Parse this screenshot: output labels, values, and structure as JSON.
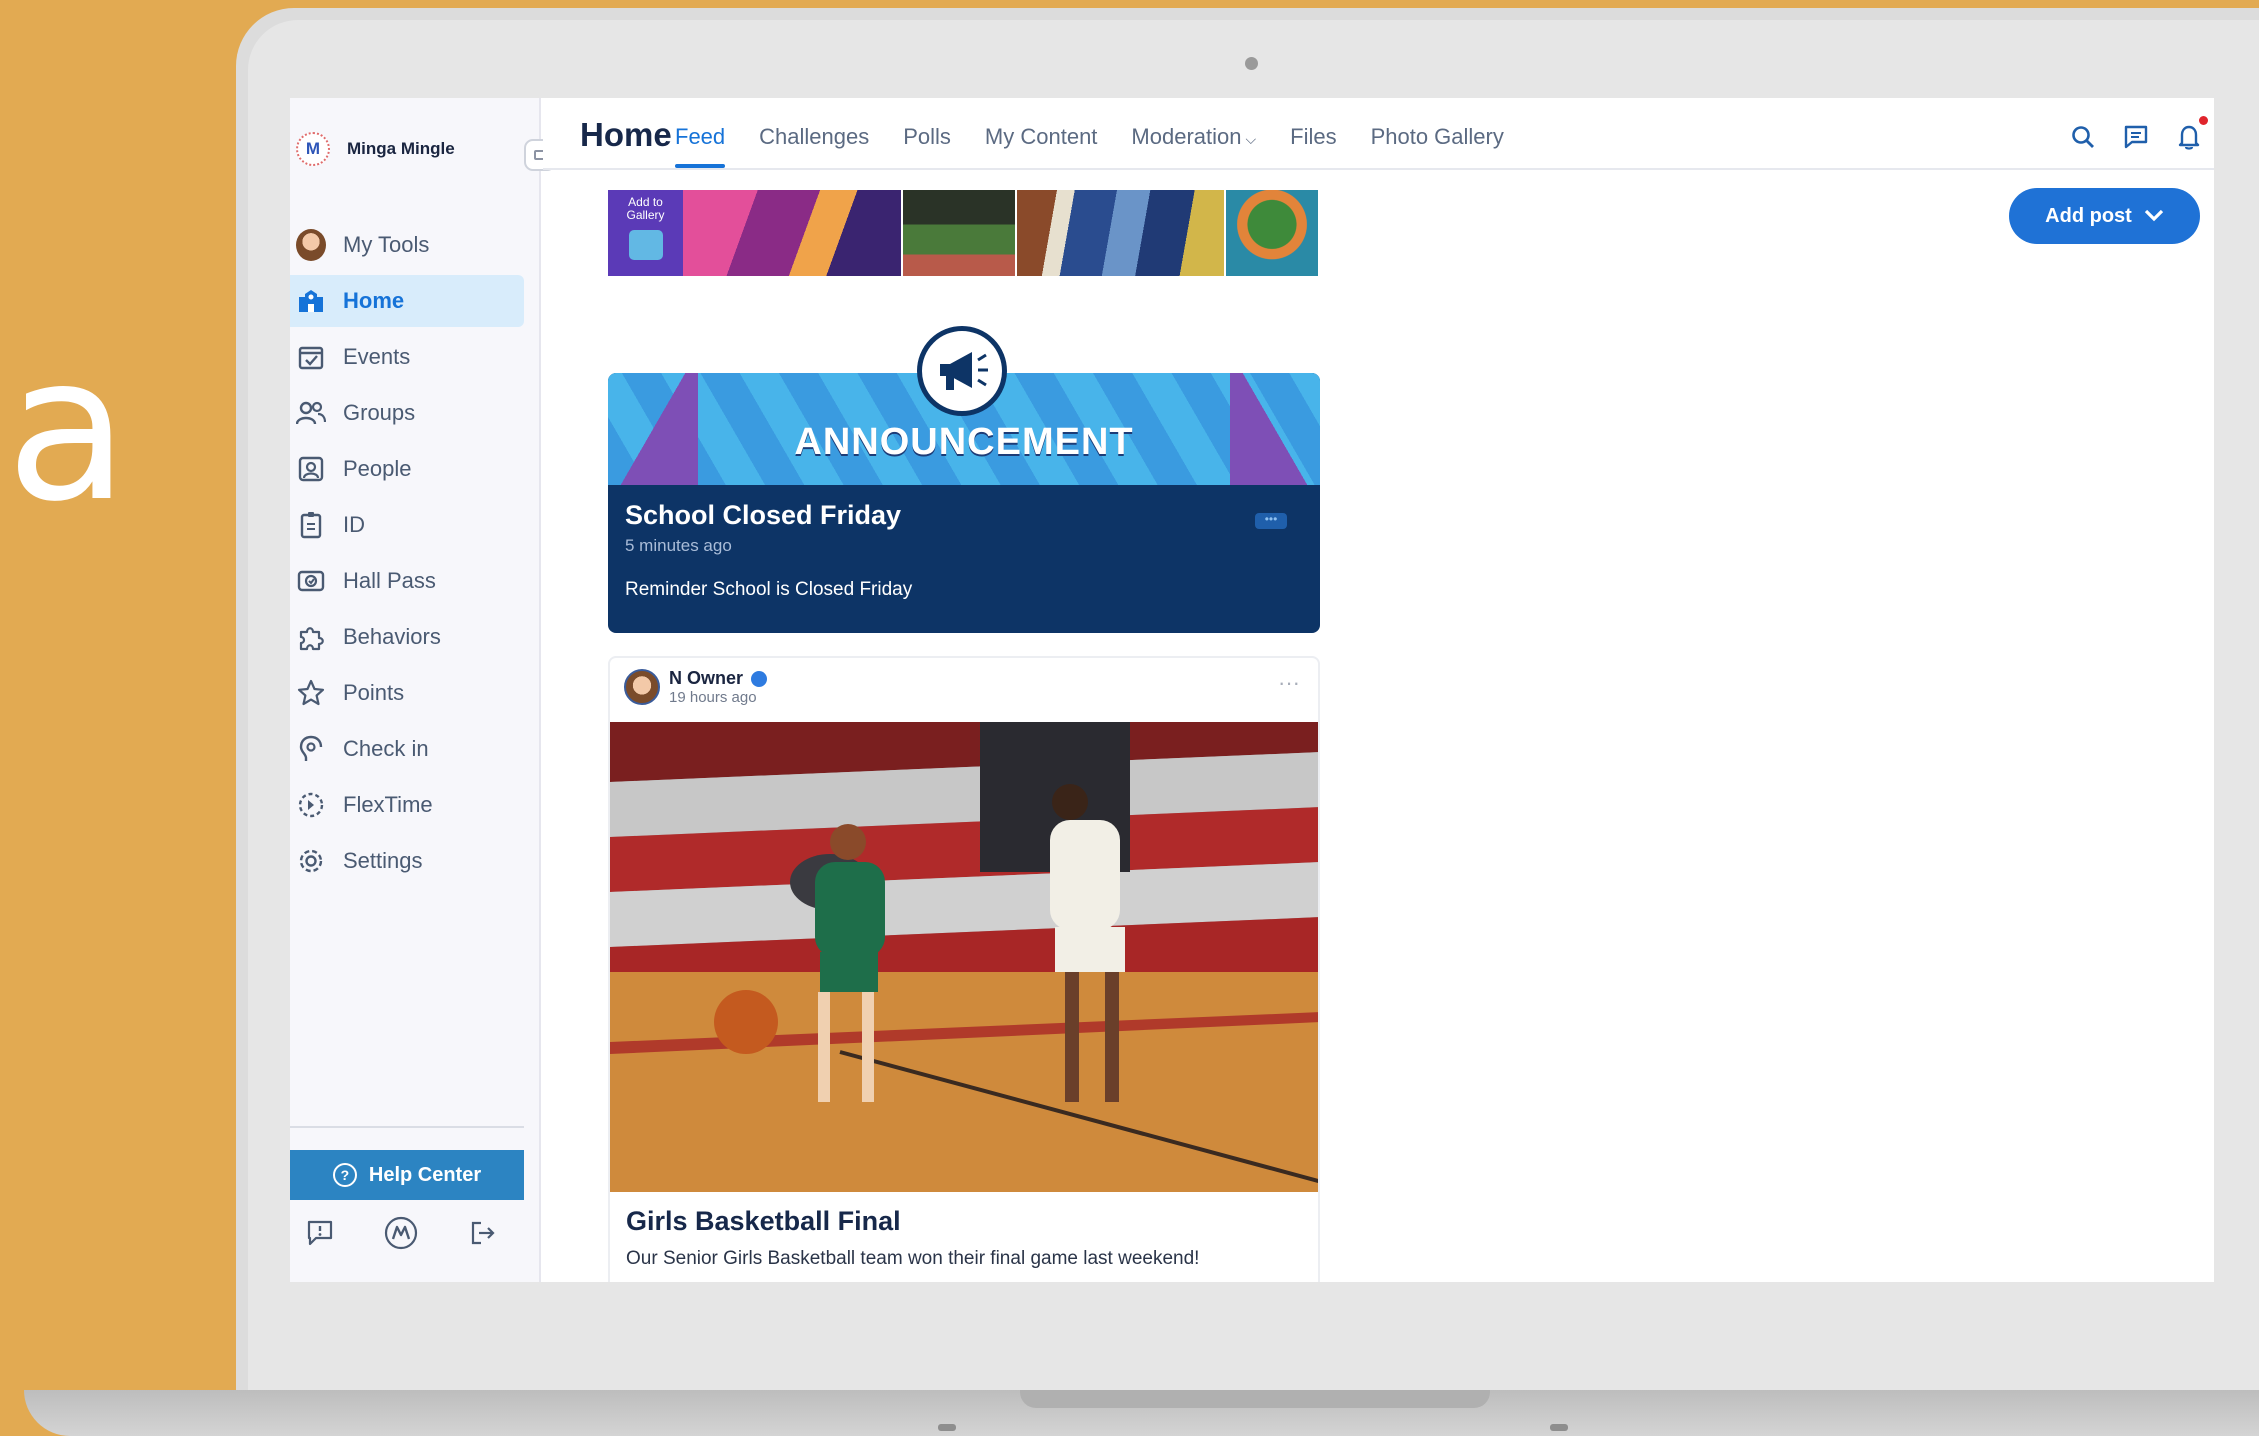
{
  "background_text": "a",
  "brand": {
    "name": "Minga Mingle",
    "logo_letter": "M"
  },
  "sidebar": {
    "items": [
      {
        "label": "My Tools",
        "icon": "user-avatar-icon"
      },
      {
        "label": "Home",
        "icon": "school-icon",
        "active": true
      },
      {
        "label": "Events",
        "icon": "calendar-check-icon"
      },
      {
        "label": "Groups",
        "icon": "groups-icon"
      },
      {
        "label": "People",
        "icon": "person-badge-icon"
      },
      {
        "label": "ID",
        "icon": "id-card-icon"
      },
      {
        "label": "Hall Pass",
        "icon": "hall-pass-icon"
      },
      {
        "label": "Behaviors",
        "icon": "puzzle-icon"
      },
      {
        "label": "Points",
        "icon": "star-icon"
      },
      {
        "label": "Check in",
        "icon": "check-in-icon"
      },
      {
        "label": "FlexTime",
        "icon": "flextime-icon"
      },
      {
        "label": "Settings",
        "icon": "gear-icon"
      }
    ],
    "help_label": "Help Center"
  },
  "header": {
    "title": "Home",
    "tabs": [
      {
        "label": "Feed",
        "active": true
      },
      {
        "label": "Challenges"
      },
      {
        "label": "Polls"
      },
      {
        "label": "My Content"
      },
      {
        "label": "Moderation",
        "dropdown": true
      },
      {
        "label": "Files"
      },
      {
        "label": "Photo Gallery"
      }
    ]
  },
  "add_post_label": "Add post",
  "gallery": {
    "add_label": "Add to Gallery"
  },
  "announcement": {
    "banner_text": "ANNOUNCEMENT",
    "title": "School Closed Friday",
    "time": "5 minutes ago",
    "body": "Reminder School is Closed Friday"
  },
  "post": {
    "author": "N Owner",
    "time": "19 hours ago",
    "title": "Girls Basketball Final",
    "body": "Our Senior Girls Basketball team won their final game last weekend!"
  },
  "colors": {
    "accent": "#1673d8",
    "announcement_bg": "#0d3466",
    "page_bg": "#e2aa52",
    "help_button": "#2c84c2"
  }
}
